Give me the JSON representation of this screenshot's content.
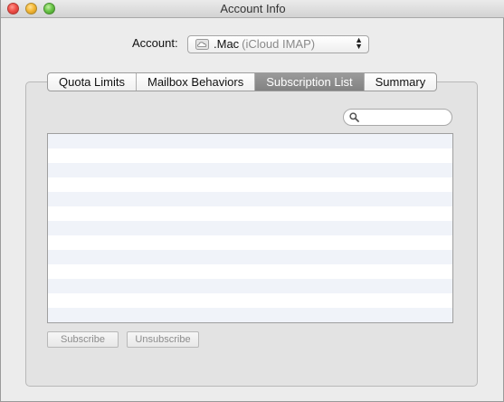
{
  "window": {
    "title": "Account Info"
  },
  "account": {
    "label": "Account:",
    "name": ".Mac",
    "type": "(iCloud IMAP)"
  },
  "tabs": [
    {
      "label": "Quota Limits",
      "active": false
    },
    {
      "label": "Mailbox Behaviors",
      "active": false
    },
    {
      "label": "Subscription List",
      "active": true
    },
    {
      "label": "Summary",
      "active": false
    }
  ],
  "search": {
    "value": "",
    "placeholder": ""
  },
  "subscription_list": {
    "rows": []
  },
  "buttons": {
    "subscribe": "Subscribe",
    "unsubscribe": "Unsubscribe"
  }
}
